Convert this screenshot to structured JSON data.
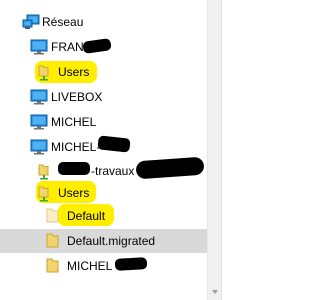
{
  "tree": {
    "items": [
      {
        "label": "Réseau",
        "icon": "network-icon"
      },
      {
        "label": "FRANC",
        "icon": "computer-icon"
      },
      {
        "label": "Users",
        "icon": "shared-folder-icon"
      },
      {
        "label": "LIVEBOX",
        "icon": "computer-icon"
      },
      {
        "label": "MICHEL",
        "icon": "computer-icon"
      },
      {
        "label": "MICHEL-",
        "icon": "computer-icon"
      },
      {
        "label": "-travaux",
        "icon": "shared-folder-icon"
      },
      {
        "label": "Users",
        "icon": "shared-folder-icon"
      },
      {
        "label": "Default",
        "icon": "folder-icon"
      },
      {
        "label": "Default.migrated",
        "icon": "folder-icon"
      },
      {
        "label": "MICHEL",
        "icon": "folder-icon"
      }
    ]
  },
  "colors": {
    "highlight": "#ffee00",
    "selection": "#d9d9d9",
    "monitor_blue": "#1e88d8",
    "folder_yellow": "#f3d36b",
    "share_green": "#3aa935"
  }
}
